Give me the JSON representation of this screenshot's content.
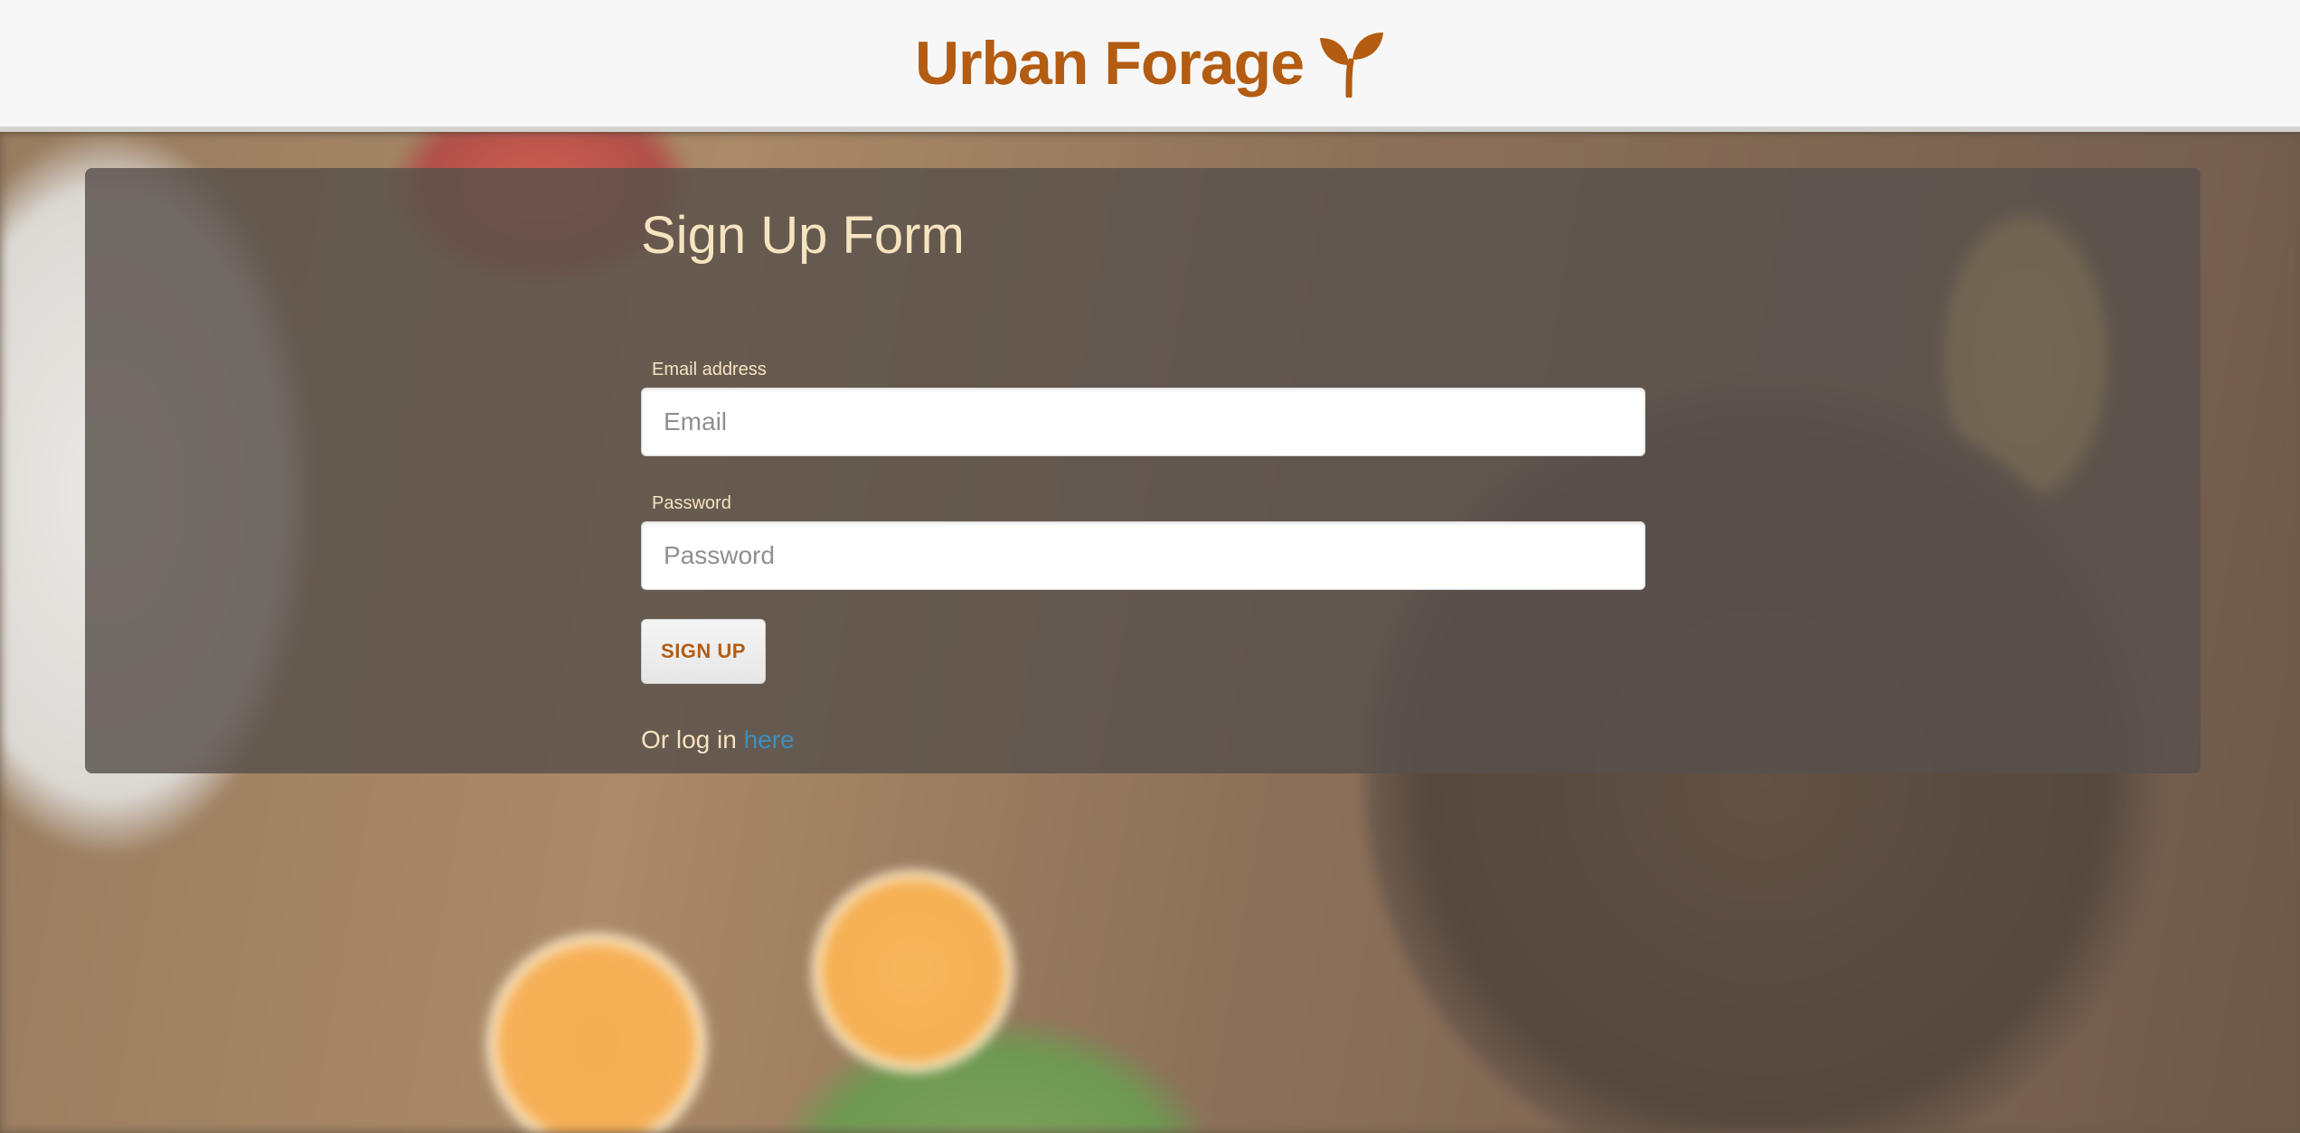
{
  "header": {
    "brand_title": "Urban Forage",
    "brand_icon": "sprout-icon",
    "brand_color": "#b35c12"
  },
  "form": {
    "title": "Sign Up Form",
    "email_label": "Email address",
    "email_placeholder": "Email",
    "email_value": "",
    "password_label": "Password",
    "password_placeholder": "Password",
    "password_value": "",
    "submit_label": "SIGN UP",
    "login_prompt": "Or log in",
    "login_link_text": "here"
  },
  "colors": {
    "accent": "#b35c12",
    "title_text": "#f6e3bf",
    "link": "#3b8ec2",
    "panel": "rgba(88, 80, 76, 0.82)"
  }
}
